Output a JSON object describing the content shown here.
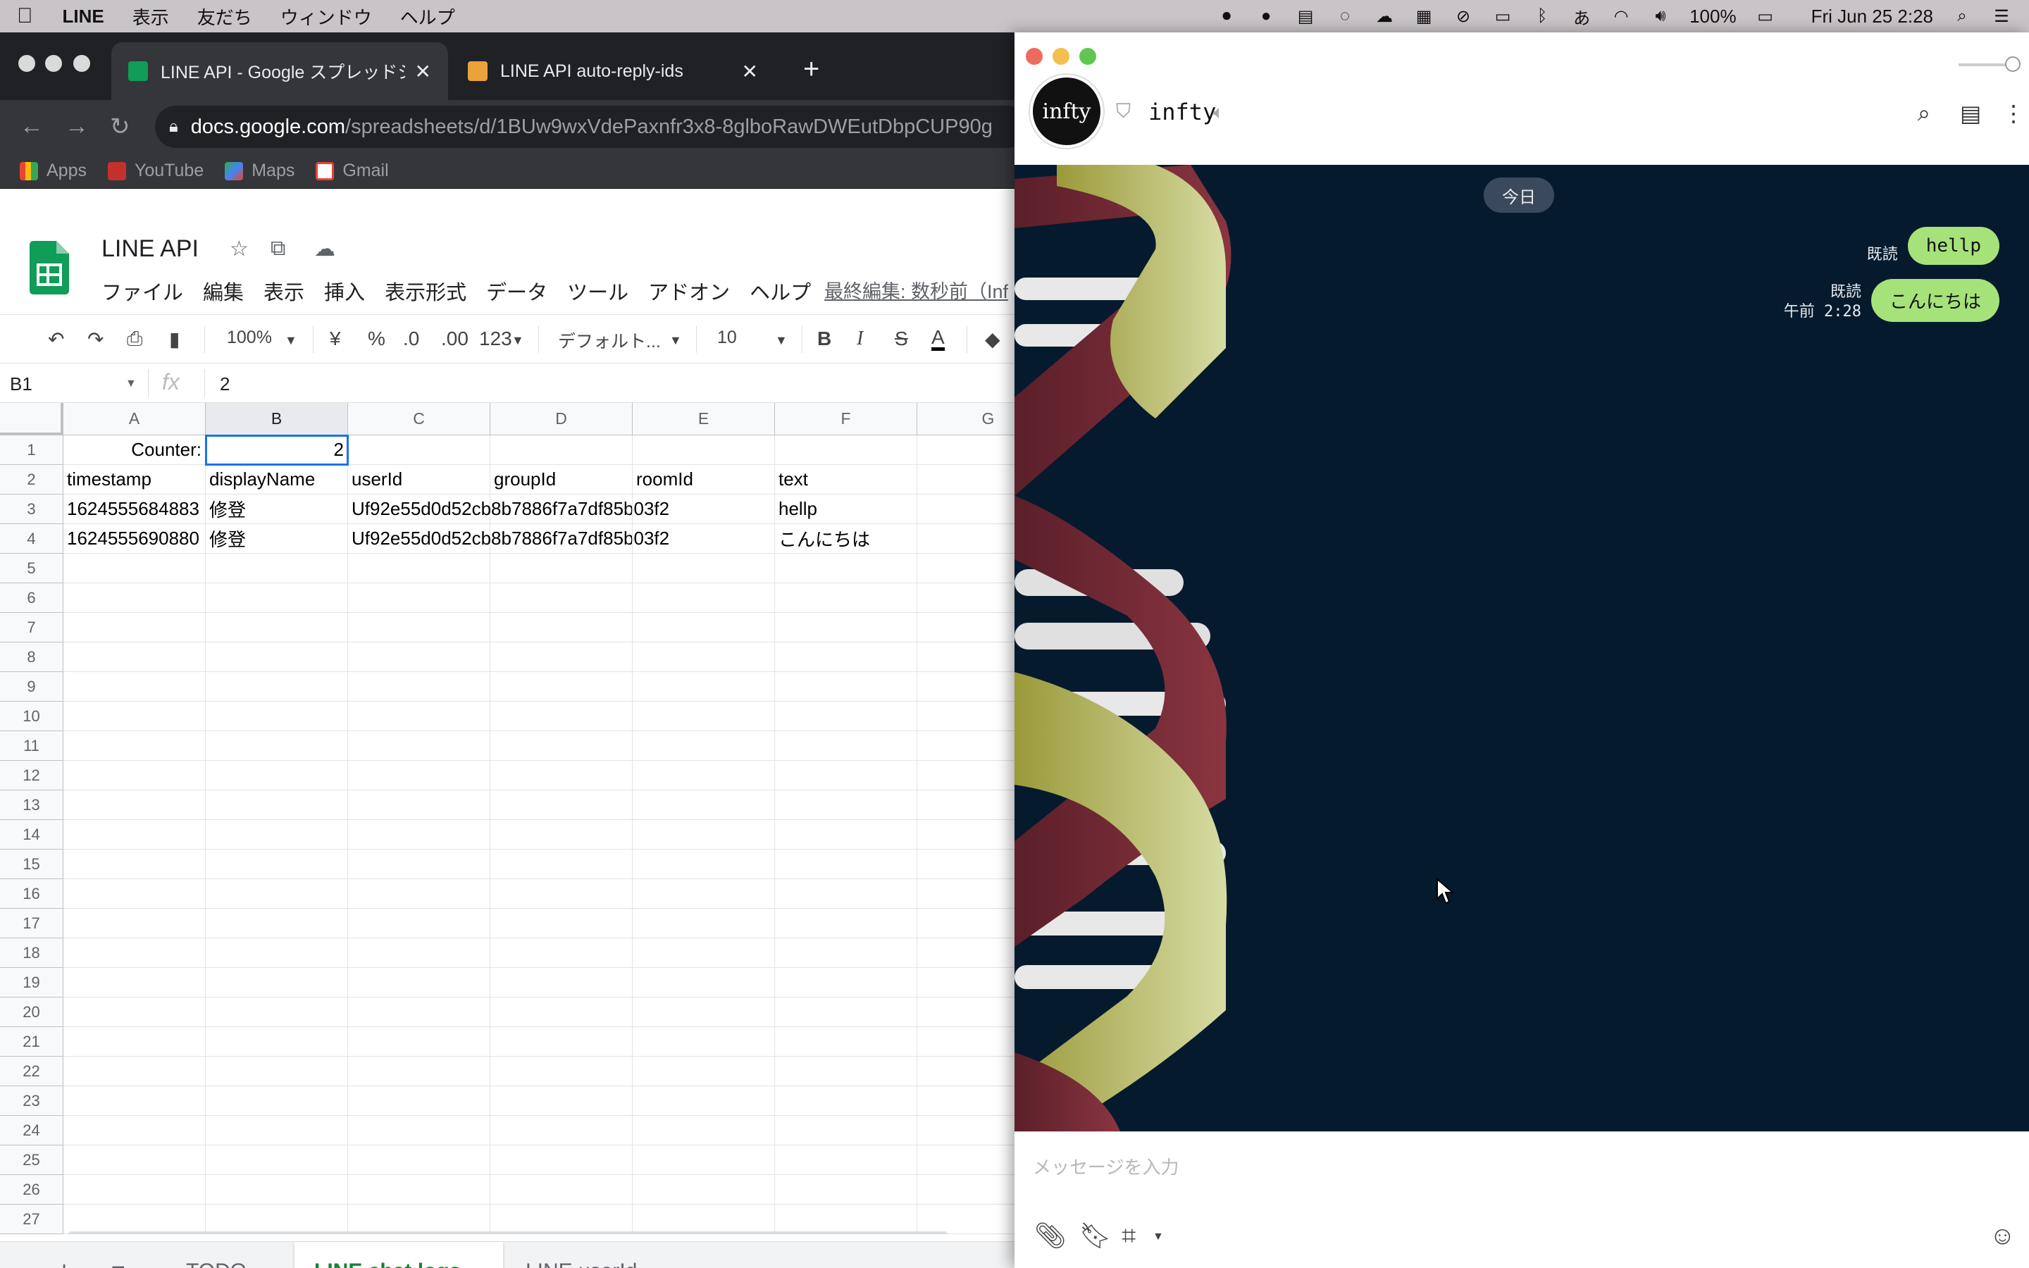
{
  "menubar": {
    "app_name": "LINE",
    "items": [
      "表示",
      "友だち",
      "ウィンドウ",
      "ヘルプ"
    ],
    "battery": "100%",
    "datetime": "Fri Jun 25  2:28"
  },
  "browser": {
    "tabs": [
      {
        "title": "LINE API - Google スプレッドシート",
        "active": true
      },
      {
        "title": "LINE API auto-reply-ids",
        "active": false
      }
    ],
    "url_host": "docs.google.com",
    "url_path": "/spreadsheets/d/1BUw9wxVdePaxnfr3x8-8glboRawDWEutDbpCUP90g",
    "bookmarks": [
      "Apps",
      "YouTube",
      "Maps",
      "Gmail"
    ]
  },
  "sheets": {
    "doc_title": "LINE API",
    "menus": [
      "ファイル",
      "編集",
      "表示",
      "挿入",
      "表示形式",
      "データ",
      "ツール",
      "アドオン",
      "ヘルプ"
    ],
    "last_edit": "最終編集: 数秒前（Inf",
    "toolbar": {
      "zoom": "100%",
      "currency": "¥",
      "percent": "%",
      "dec_decrease": ".0",
      "dec_increase": ".00",
      "number_format": "123",
      "font": "デフォルト...",
      "font_size": "10"
    },
    "name_box": "B1",
    "formula_value": "2",
    "columns": [
      "A",
      "B",
      "C",
      "D",
      "E",
      "F",
      "G"
    ],
    "rows": [
      [
        "Counter:",
        "2",
        "",
        "",
        "",
        "",
        ""
      ],
      [
        "timestamp",
        "displayName",
        "userId",
        "groupId",
        "roomId",
        "text",
        ""
      ],
      [
        "1624555684883",
        "修登",
        "Uf92e55d0d52cb8b7886f7a7df85b03f2",
        "",
        "",
        "hellp",
        ""
      ],
      [
        "1624555690880",
        "修登",
        "Uf92e55d0d52cb8b7886f7a7df85b03f2",
        "",
        "",
        "こんにちは",
        ""
      ]
    ],
    "row_count": 27,
    "sheet_tabs": [
      {
        "name": "TODO",
        "active": false
      },
      {
        "name": "LINE chat logs",
        "active": true
      },
      {
        "name": "LINE userId",
        "active": false
      }
    ]
  },
  "line": {
    "chat_name": "infty",
    "avatar_text": "infty",
    "date_label": "今日",
    "messages": [
      {
        "text": "hellp",
        "read": "既読",
        "time": ""
      },
      {
        "text": "こんにちは",
        "read": "既読",
        "time": "午前 2:28"
      }
    ],
    "input_placeholder": "メッセージを入力",
    "colors": {
      "bubble": "#a6e27a",
      "chat_bg": "#061a2e"
    }
  }
}
